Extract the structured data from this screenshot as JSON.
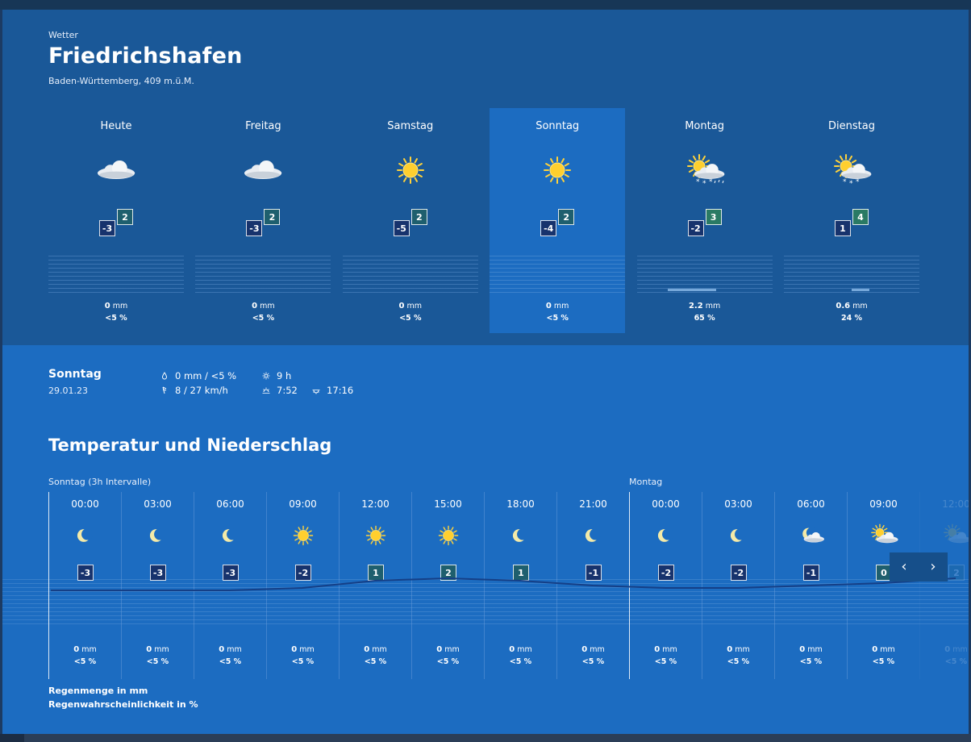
{
  "header": {
    "kicker": "Wetter",
    "city": "Friedrichshafen",
    "region": "Baden-Württemberg, 409 m.ü.M."
  },
  "days": [
    {
      "name": "Heute",
      "icon": "cloud",
      "min": "-3",
      "max": "2",
      "amount": "0",
      "unit": "mm",
      "prob": "<5 %",
      "rain_fraction": 0
    },
    {
      "name": "Freitag",
      "icon": "cloud",
      "min": "-3",
      "max": "2",
      "amount": "0",
      "unit": "mm",
      "prob": "<5 %",
      "rain_fraction": 0
    },
    {
      "name": "Samstag",
      "icon": "sun",
      "min": "-5",
      "max": "2",
      "amount": "0",
      "unit": "mm",
      "prob": "<5 %",
      "rain_fraction": 0
    },
    {
      "name": "Sonntag",
      "icon": "sun",
      "min": "-4",
      "max": "2",
      "amount": "0",
      "unit": "mm",
      "prob": "<5 %",
      "rain_fraction": 0,
      "selected": true
    },
    {
      "name": "Montag",
      "icon": "sun-cloud-snow-rain",
      "min": "-2",
      "max": "3",
      "amount": "2.2",
      "unit": "mm",
      "prob": "65 %",
      "rain_fraction": 0.65
    },
    {
      "name": "Dienstag",
      "icon": "sun-cloud-snow",
      "min": "1",
      "max": "4",
      "amount": "0.6",
      "unit": "mm",
      "prob": "24 %",
      "rain_fraction": 0.24
    }
  ],
  "detail": {
    "day": "Sonntag",
    "date": "29.01.23",
    "precip": "0 mm / <5 %",
    "wind": "8 / 27 km/h",
    "sunshine": "9 h",
    "sunrise": "7:52",
    "sunset": "17:16",
    "icons": [
      "drop-icon",
      "wind-icon",
      "sun-icon",
      "sunrise-icon",
      "sunset-icon"
    ]
  },
  "hourly": {
    "title": "Temperatur und Niederschlag",
    "interval_label": "Sonntag (3h Intervalle)",
    "monday_label": "Montag",
    "slots": [
      {
        "time": "00:00",
        "icon": "moon",
        "temp": "-3",
        "amount": "0",
        "unit": "mm",
        "prob": "<5 %"
      },
      {
        "time": "03:00",
        "icon": "moon",
        "temp": "-3",
        "amount": "0",
        "unit": "mm",
        "prob": "<5 %"
      },
      {
        "time": "06:00",
        "icon": "moon",
        "temp": "-3",
        "amount": "0",
        "unit": "mm",
        "prob": "<5 %"
      },
      {
        "time": "09:00",
        "icon": "sun",
        "temp": "-2",
        "amount": "0",
        "unit": "mm",
        "prob": "<5 %"
      },
      {
        "time": "12:00",
        "icon": "sun",
        "temp": "1",
        "amount": "0",
        "unit": "mm",
        "prob": "<5 %"
      },
      {
        "time": "15:00",
        "icon": "sun",
        "temp": "2",
        "amount": "0",
        "unit": "mm",
        "prob": "<5 %"
      },
      {
        "time": "18:00",
        "icon": "moon",
        "temp": "1",
        "amount": "0",
        "unit": "mm",
        "prob": "<5 %"
      },
      {
        "time": "21:00",
        "icon": "moon",
        "temp": "-1",
        "amount": "0",
        "unit": "mm",
        "prob": "<5 %"
      },
      {
        "time": "00:00",
        "icon": "moon",
        "temp": "-2",
        "amount": "0",
        "unit": "mm",
        "prob": "<5 %",
        "day_start": true
      },
      {
        "time": "03:00",
        "icon": "moon",
        "temp": "-2",
        "amount": "0",
        "unit": "mm",
        "prob": "<5 %"
      },
      {
        "time": "06:00",
        "icon": "moon-cloud",
        "temp": "-1",
        "amount": "0",
        "unit": "mm",
        "prob": "<5 %"
      },
      {
        "time": "09:00",
        "icon": "sun-cloud",
        "temp": "0",
        "amount": "0",
        "unit": "mm",
        "prob": "<5 %"
      },
      {
        "time": "12:00",
        "icon": "sun-cloud",
        "temp": "2",
        "amount": "0",
        "unit": "mm",
        "prob": "<5 %",
        "faded": true
      }
    ],
    "nav": {
      "prev": "‹",
      "next": "›"
    },
    "legend_amount": "Regenmenge in mm",
    "legend_prob": "Regenwahrscheinlichkeit in %"
  },
  "colors": {
    "top_bg": "#1a5898",
    "bottom_bg": "#1c6cc1",
    "selected_bg": "#1c6cc1",
    "temp_line": "#153f86"
  }
}
